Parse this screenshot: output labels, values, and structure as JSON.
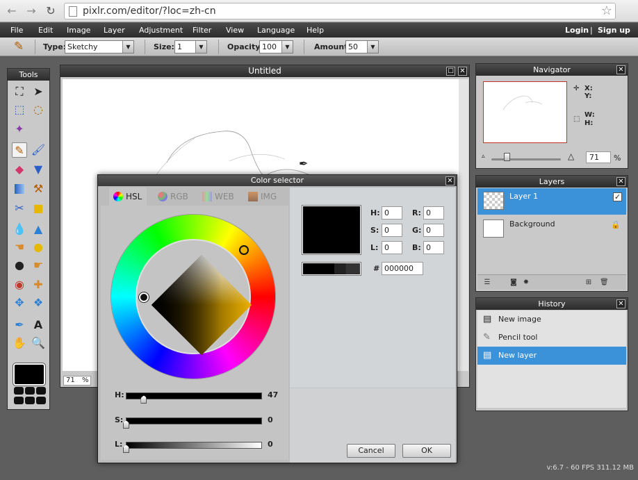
{
  "browser": {
    "back": "←",
    "forward": "→",
    "reload": "↻",
    "url": "pixlr.com/editor/?loc=zh-cn",
    "star": "☆"
  },
  "menu": {
    "items": [
      "File",
      "Edit",
      "Image",
      "Layer",
      "Adjustment",
      "Filter",
      "View",
      "Language",
      "Help"
    ],
    "login": "Login",
    "divider": "|",
    "signup": "Sign up"
  },
  "options": {
    "type_label": "Type:",
    "type_value": "Sketchy",
    "size_label": "Size:",
    "size_value": "1",
    "opacity_label": "Opacity:",
    "opacity_value": "100",
    "amount_label": "Amount:",
    "amount_value": "50",
    "dropdown_glyph": "▼"
  },
  "tools": {
    "title": "Tools",
    "foreground_color": "#000000"
  },
  "canvas": {
    "title": "Untitled",
    "zoom": "71",
    "zoom_unit": "%"
  },
  "color_selector": {
    "title": "Color selector",
    "tabs": [
      "HSL",
      "RGB",
      "WEB",
      "IMG"
    ],
    "active_tab": "HSL",
    "sliders": {
      "h_label": "H:",
      "h_value": "47",
      "h_fraction": 0.13,
      "s_label": "S:",
      "s_value": "0",
      "s_fraction": 0.0,
      "l_label": "L:",
      "l_value": "0",
      "l_fraction": 0.0
    },
    "fields": {
      "h_label": "H:",
      "h": "0",
      "s_label": "S:",
      "s": "0",
      "l_label": "L:",
      "l": "0",
      "r_label": "R:",
      "r": "0",
      "g_label": "G:",
      "g": "0",
      "b_label": "B:",
      "b": "0",
      "hex_label": "#",
      "hex": "000000"
    },
    "cancel": "Cancel",
    "ok": "OK"
  },
  "navigator": {
    "title": "Navigator",
    "x_label": "X:",
    "y_label": "Y:",
    "w_label": "W:",
    "h_label": "H:",
    "zoom": "71",
    "zoom_unit": "%"
  },
  "layers": {
    "title": "Layers",
    "items": [
      {
        "name": "Layer 1",
        "selected": true
      },
      {
        "name": "Background",
        "selected": false
      }
    ]
  },
  "history": {
    "title": "History",
    "items": [
      {
        "name": "New image",
        "selected": false
      },
      {
        "name": "Pencil tool",
        "selected": false
      },
      {
        "name": "New layer",
        "selected": true
      }
    ]
  },
  "status": "v:6.7 - 60 FPS 311.12 MB"
}
